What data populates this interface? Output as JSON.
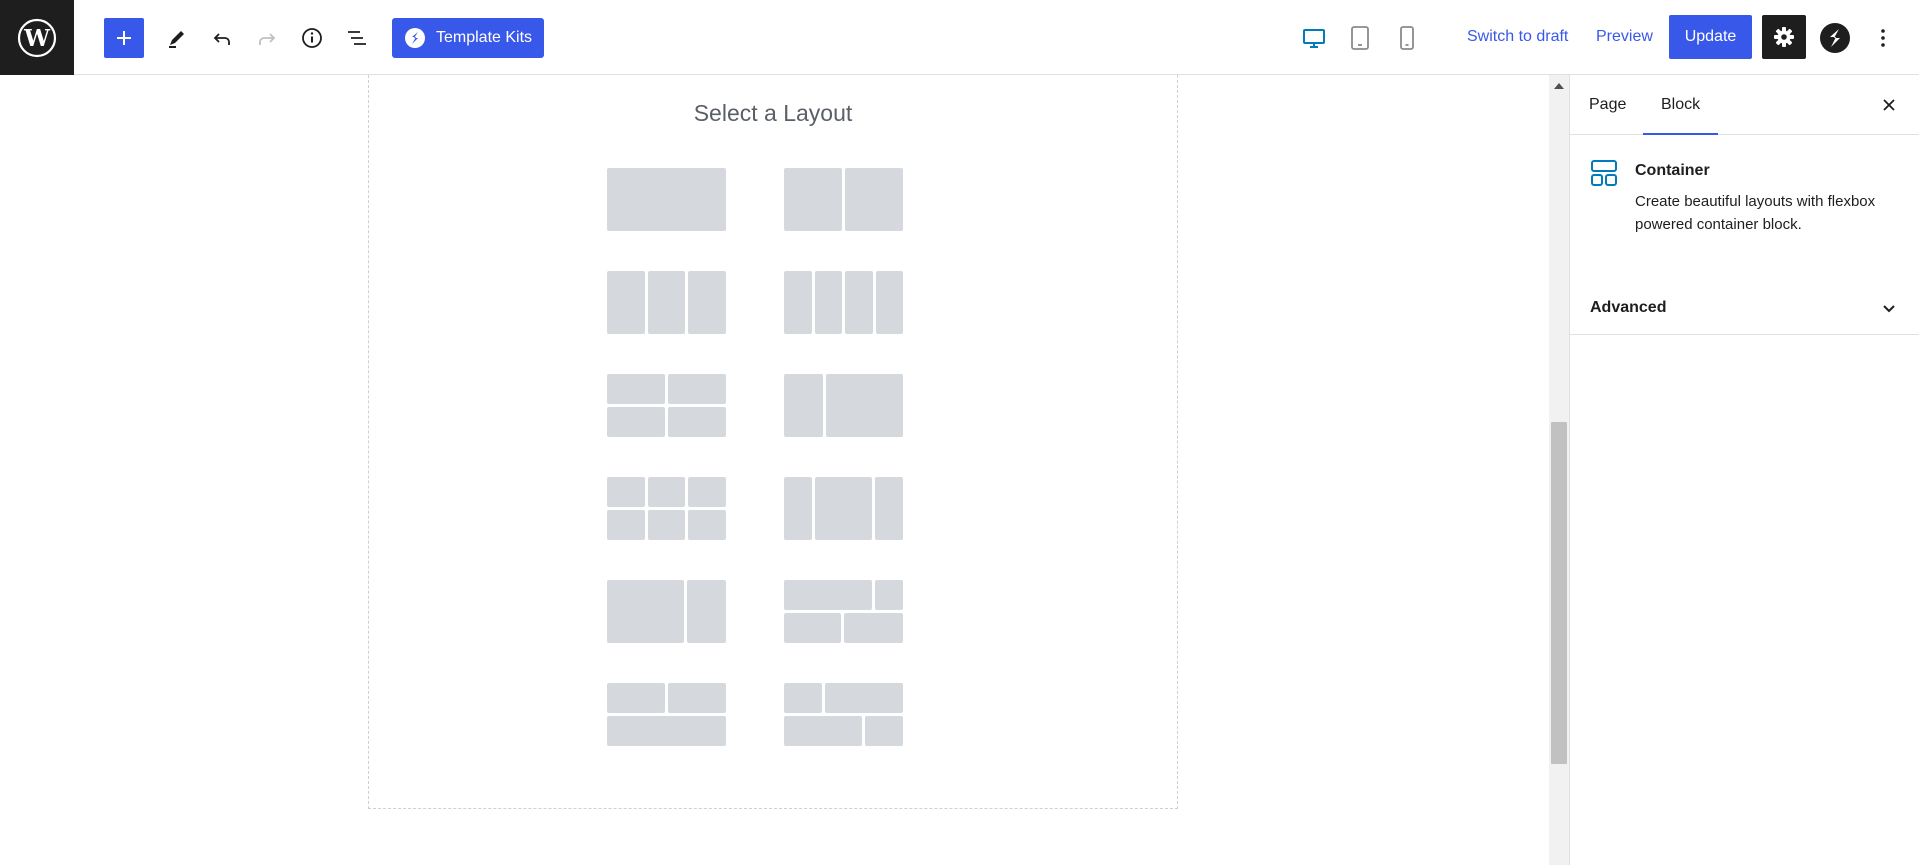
{
  "toolbar": {
    "template_kits_label": "Template Kits",
    "switch_to_draft_label": "Switch to draft",
    "preview_label": "Preview",
    "update_label": "Update",
    "icons": [
      "wordpress-logo-icon",
      "plus-icon",
      "pencil-icon",
      "undo-icon",
      "redo-icon",
      "info-icon",
      "list-view-icon",
      "desktop-icon",
      "tablet-icon",
      "mobile-icon",
      "gear-icon",
      "spectra-icon",
      "kebab-menu-icon"
    ]
  },
  "canvas": {
    "layout_title": "Select a Layout",
    "layouts": [
      "1",
      "1-1",
      "1-1-1",
      "1-1-1-1",
      "2x2",
      "1-2",
      "2x3",
      "1-2-1",
      "2-1",
      "row-2-1/1-2",
      "2-over-1",
      "row-1-2/2-1"
    ]
  },
  "sidebar": {
    "tabs": [
      "Page",
      "Block"
    ],
    "active_tab": "Block",
    "block_name": "Container",
    "block_description": "Create beautiful layouts with flexbox powered container block.",
    "advanced_label": "Advanced"
  },
  "colors": {
    "accent": "#3858e9",
    "dark": "#1e1e1e",
    "tile": "#d5d9dd",
    "device_active": "#007cba"
  }
}
